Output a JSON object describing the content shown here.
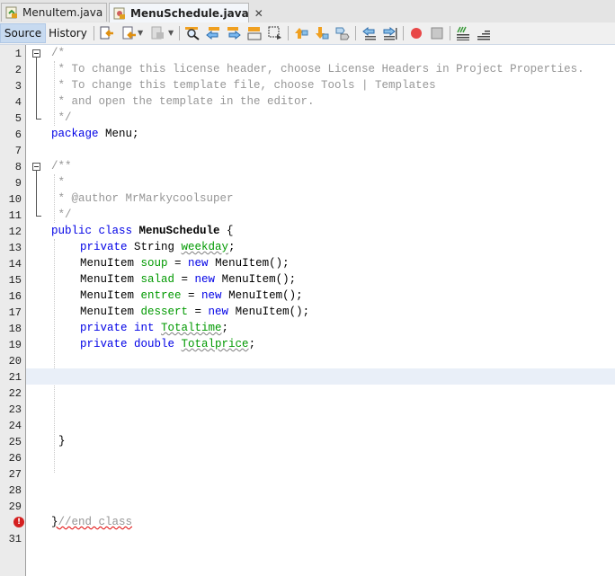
{
  "tabs": [
    {
      "label": "MenuItem.java",
      "active": false,
      "close": "✕"
    },
    {
      "label": "MenuSchedule.java",
      "active": true,
      "close": "✕"
    }
  ],
  "toolbar": {
    "source_label": "Source",
    "history_label": "History"
  },
  "editor": {
    "line_numbers": [
      "1",
      "2",
      "3",
      "4",
      "5",
      "6",
      "7",
      "8",
      "9",
      "10",
      "11",
      "12",
      "13",
      "14",
      "15",
      "16",
      "17",
      "18",
      "19",
      "20",
      "21",
      "22",
      "23",
      "24",
      "25",
      "26",
      "27",
      "28",
      "29",
      "30",
      "31"
    ],
    "error_line": "30",
    "current_line": "21",
    "lines": {
      "l1": "/*",
      "l2": " * To change this license header, choose License Headers in Project Properties.",
      "l3": " * To change this template file, choose Tools | Templates",
      "l4": " * and open the template in the editor.",
      "l5": " */",
      "l6_kw": "package",
      "l6_rest": " Menu;",
      "l8": "/**",
      "l9": " *",
      "l10": " * @author MrMarkycoolsuper",
      "l11": " */",
      "l12_kw": "public class",
      "l12_name": "MenuSchedule",
      "l12_rest": " {",
      "l13_kw": "private",
      "l13_type": " String ",
      "l13_var": "weekday",
      "l13_end": ";",
      "l14_type": "MenuItem ",
      "l14_var": "soup",
      "l14_eq": " = ",
      "l14_kw": "new",
      "l14_rest": " MenuItem();",
      "l15_type": "MenuItem ",
      "l15_var": "salad",
      "l15_eq": " = ",
      "l15_kw": "new",
      "l15_rest": " MenuItem();",
      "l16_type": "MenuItem ",
      "l16_var": "entree",
      "l16_eq": " = ",
      "l16_kw": "new",
      "l16_rest": " MenuItem();",
      "l17_type": "MenuItem ",
      "l17_var": "dessert",
      "l17_eq": " = ",
      "l17_kw": "new",
      "l17_rest": " MenuItem();",
      "l18_kw": "private int",
      "l18_var": "Totaltime",
      "l18_end": ";",
      "l19_kw": "private double",
      "l19_var": "Totalprice",
      "l19_end": ";",
      "l25": "}",
      "l30_brace": "}",
      "l30_cm": "//end class"
    }
  },
  "colors": {
    "keyword": "#0000e6",
    "comment": "#969696",
    "field": "#009900",
    "current_line": "#e9eff8",
    "error": "#d42020"
  }
}
